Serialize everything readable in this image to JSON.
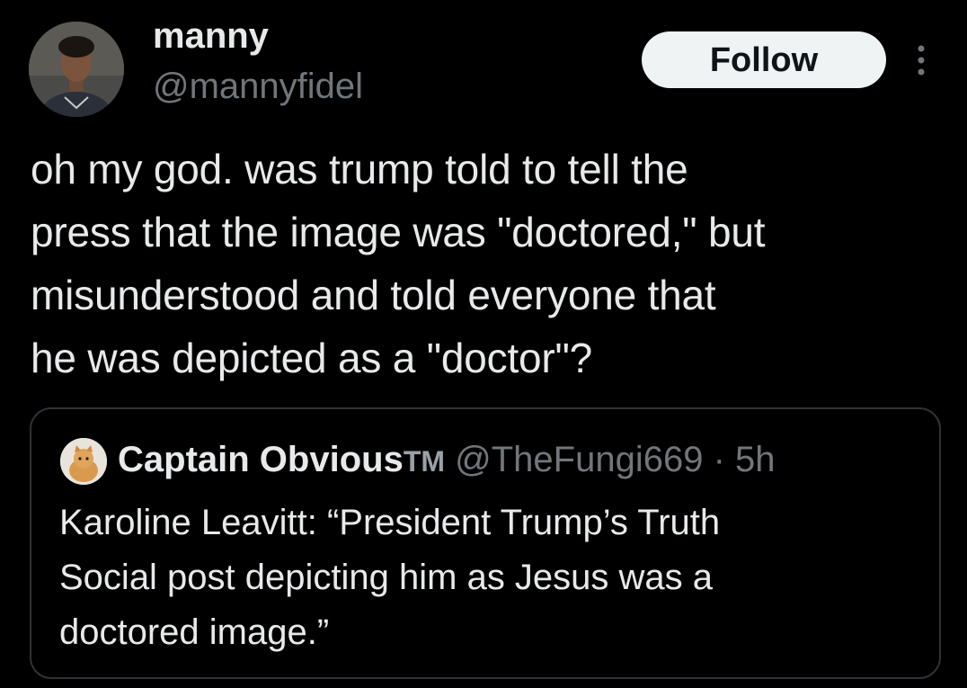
{
  "author": {
    "display_name": "manny",
    "handle": "@mannyfidel",
    "avatar_icon": "person-avatar"
  },
  "actions": {
    "follow_label": "Follow",
    "more_icon": "more-vertical-icon"
  },
  "tweet": {
    "lines": [
      "oh my god. was trump told to tell the",
      "press that the image was \"doctored,\" but",
      "misunderstood and told everyone that",
      "he was depicted as a \"doctor\"?"
    ]
  },
  "quote": {
    "display_name": "Captain Obvious",
    "tm": "TM",
    "handle": "@TheFungi669",
    "separator": "·",
    "time": "5h",
    "avatar_icon": "cat-avatar",
    "lines": [
      "Karoline Leavitt: “President Trump’s Truth",
      "Social post depicting him as Jesus was a",
      "doctored image.”"
    ]
  },
  "colors": {
    "background": "#000000",
    "primary_text": "#e7e9ea",
    "secondary_text": "#71767b",
    "border": "#2f3336",
    "follow_bg": "#eff3f4"
  }
}
